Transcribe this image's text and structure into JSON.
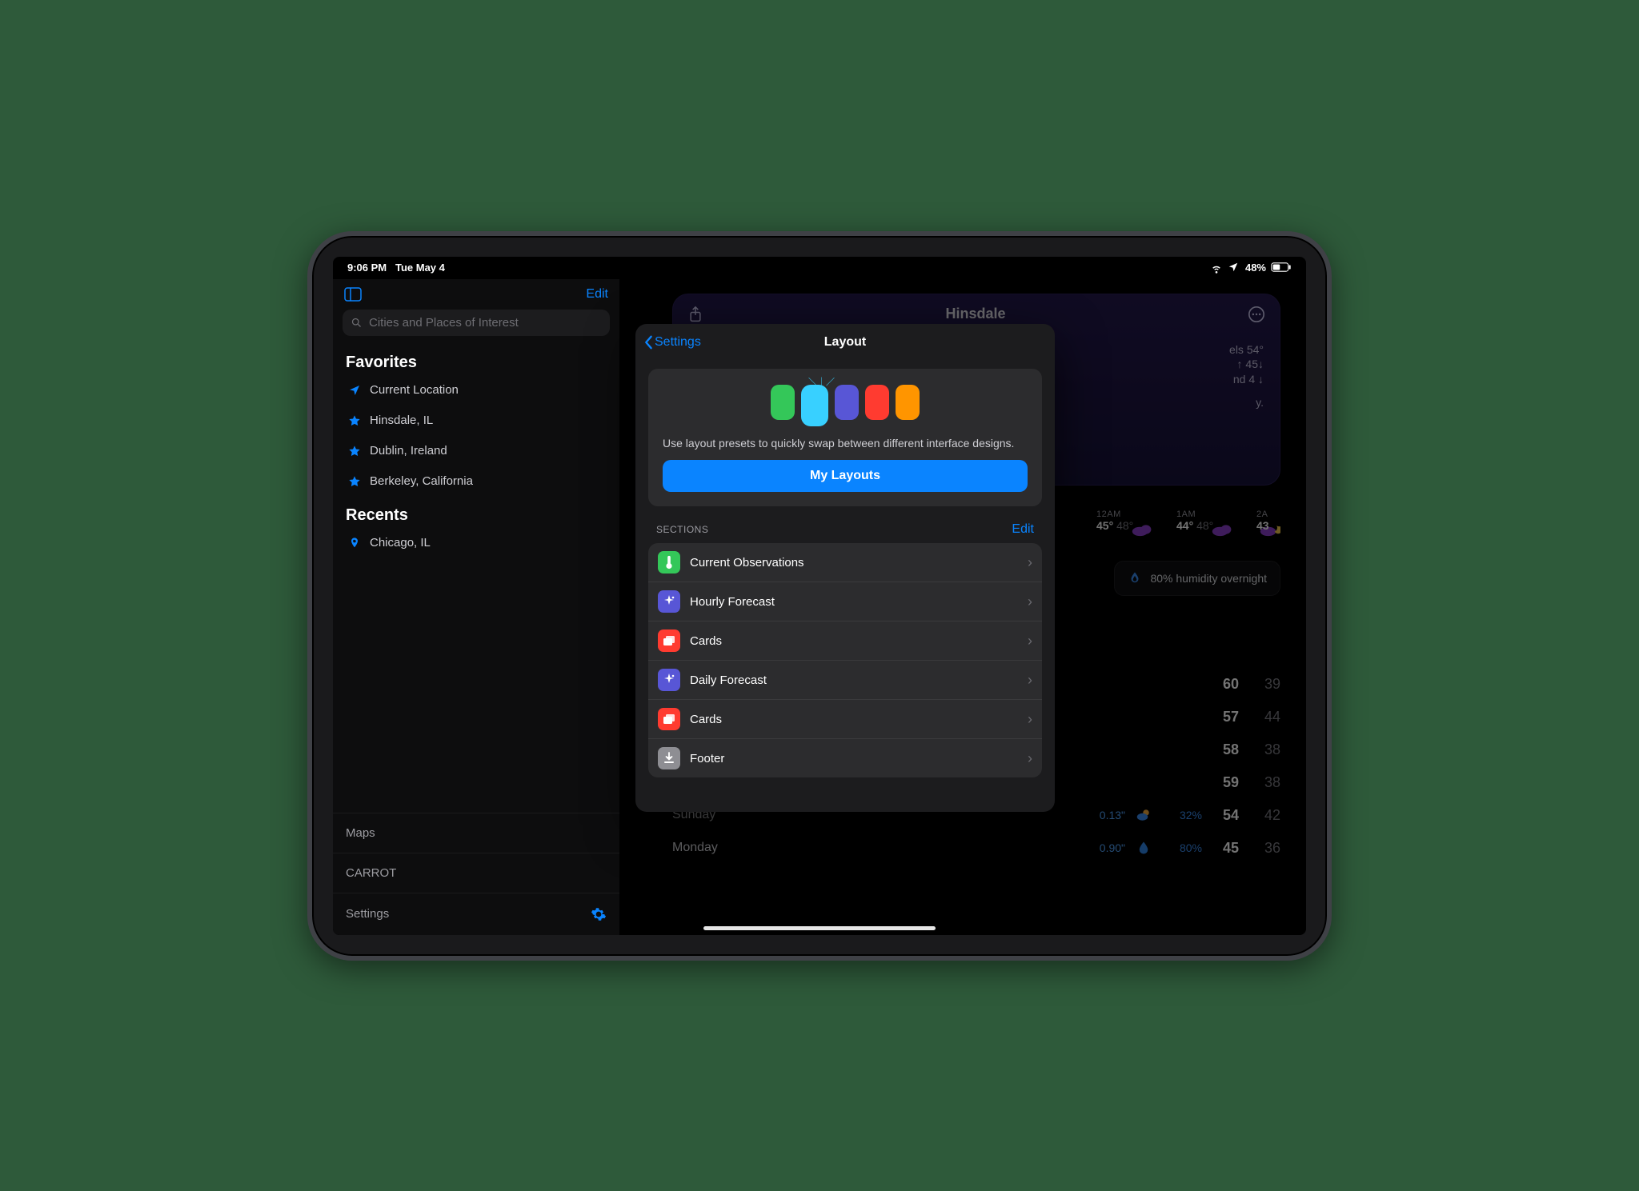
{
  "statusbar": {
    "time": "9:06 PM",
    "date": "Tue May 4",
    "battery": "48%"
  },
  "sidebar": {
    "edit_label": "Edit",
    "search_placeholder": "Cities and Places of Interest",
    "favorites_header": "Favorites",
    "favorites": [
      {
        "icon": "location-arrow",
        "label": "Current Location"
      },
      {
        "icon": "star",
        "label": "Hinsdale, IL"
      },
      {
        "icon": "star",
        "label": "Dublin, Ireland"
      },
      {
        "icon": "star",
        "label": "Berkeley, California"
      }
    ],
    "recents_header": "Recents",
    "recents": [
      {
        "icon": "pin",
        "label": "Chicago, IL"
      }
    ],
    "bottom": [
      {
        "label": "Maps"
      },
      {
        "label": "CARROT"
      },
      {
        "label": "Settings",
        "gear": true
      }
    ]
  },
  "main": {
    "city": "Hinsdale",
    "blurb_lines": [
      "els 54°",
      "↑ 45↓",
      "nd 4 ↓",
      "",
      "y."
    ],
    "hourly": [
      {
        "time": "12AM",
        "hi": "45°",
        "lo": "48°"
      },
      {
        "time": "1AM",
        "hi": "44°",
        "lo": "48°"
      },
      {
        "time": "2A",
        "hi": "43",
        "lo": ""
      }
    ],
    "humidity_chip": "80% humidity overnight",
    "daily": [
      {
        "day": "",
        "rain": "",
        "pct": "",
        "hi": "60",
        "lo": "39"
      },
      {
        "day": "",
        "rain": "",
        "pct": "",
        "hi": "57",
        "lo": "44"
      },
      {
        "day": "",
        "rain": "",
        "pct": "",
        "hi": "58",
        "lo": "38"
      },
      {
        "day": "",
        "rain": "",
        "pct": "",
        "hi": "59",
        "lo": "38"
      },
      {
        "day": "Sunday",
        "rain": "0.13\"",
        "pct": "32%",
        "hi": "54",
        "lo": "42",
        "cloud": true
      },
      {
        "day": "Monday",
        "rain": "0.90\"",
        "pct": "80%",
        "hi": "45",
        "lo": "36",
        "drop": true
      }
    ]
  },
  "popover": {
    "back_label": "Settings",
    "title": "Layout",
    "intro_text": "Use layout presets to quickly swap between different interface designs.",
    "button": "My Layouts",
    "section_header": "SECTIONS",
    "section_edit": "Edit",
    "sections": [
      {
        "color": "#34c759",
        "glyph": "thermometer",
        "label": "Current Observations"
      },
      {
        "color": "#5856d6",
        "glyph": "sparkle",
        "label": "Hourly Forecast"
      },
      {
        "color": "#ff3b30",
        "glyph": "cards",
        "label": "Cards"
      },
      {
        "color": "#5856d6",
        "glyph": "sparkle",
        "label": "Daily Forecast"
      },
      {
        "color": "#ff3b30",
        "glyph": "cards",
        "label": "Cards"
      },
      {
        "color": "#8e8e93",
        "glyph": "download",
        "label": "Footer"
      }
    ]
  }
}
